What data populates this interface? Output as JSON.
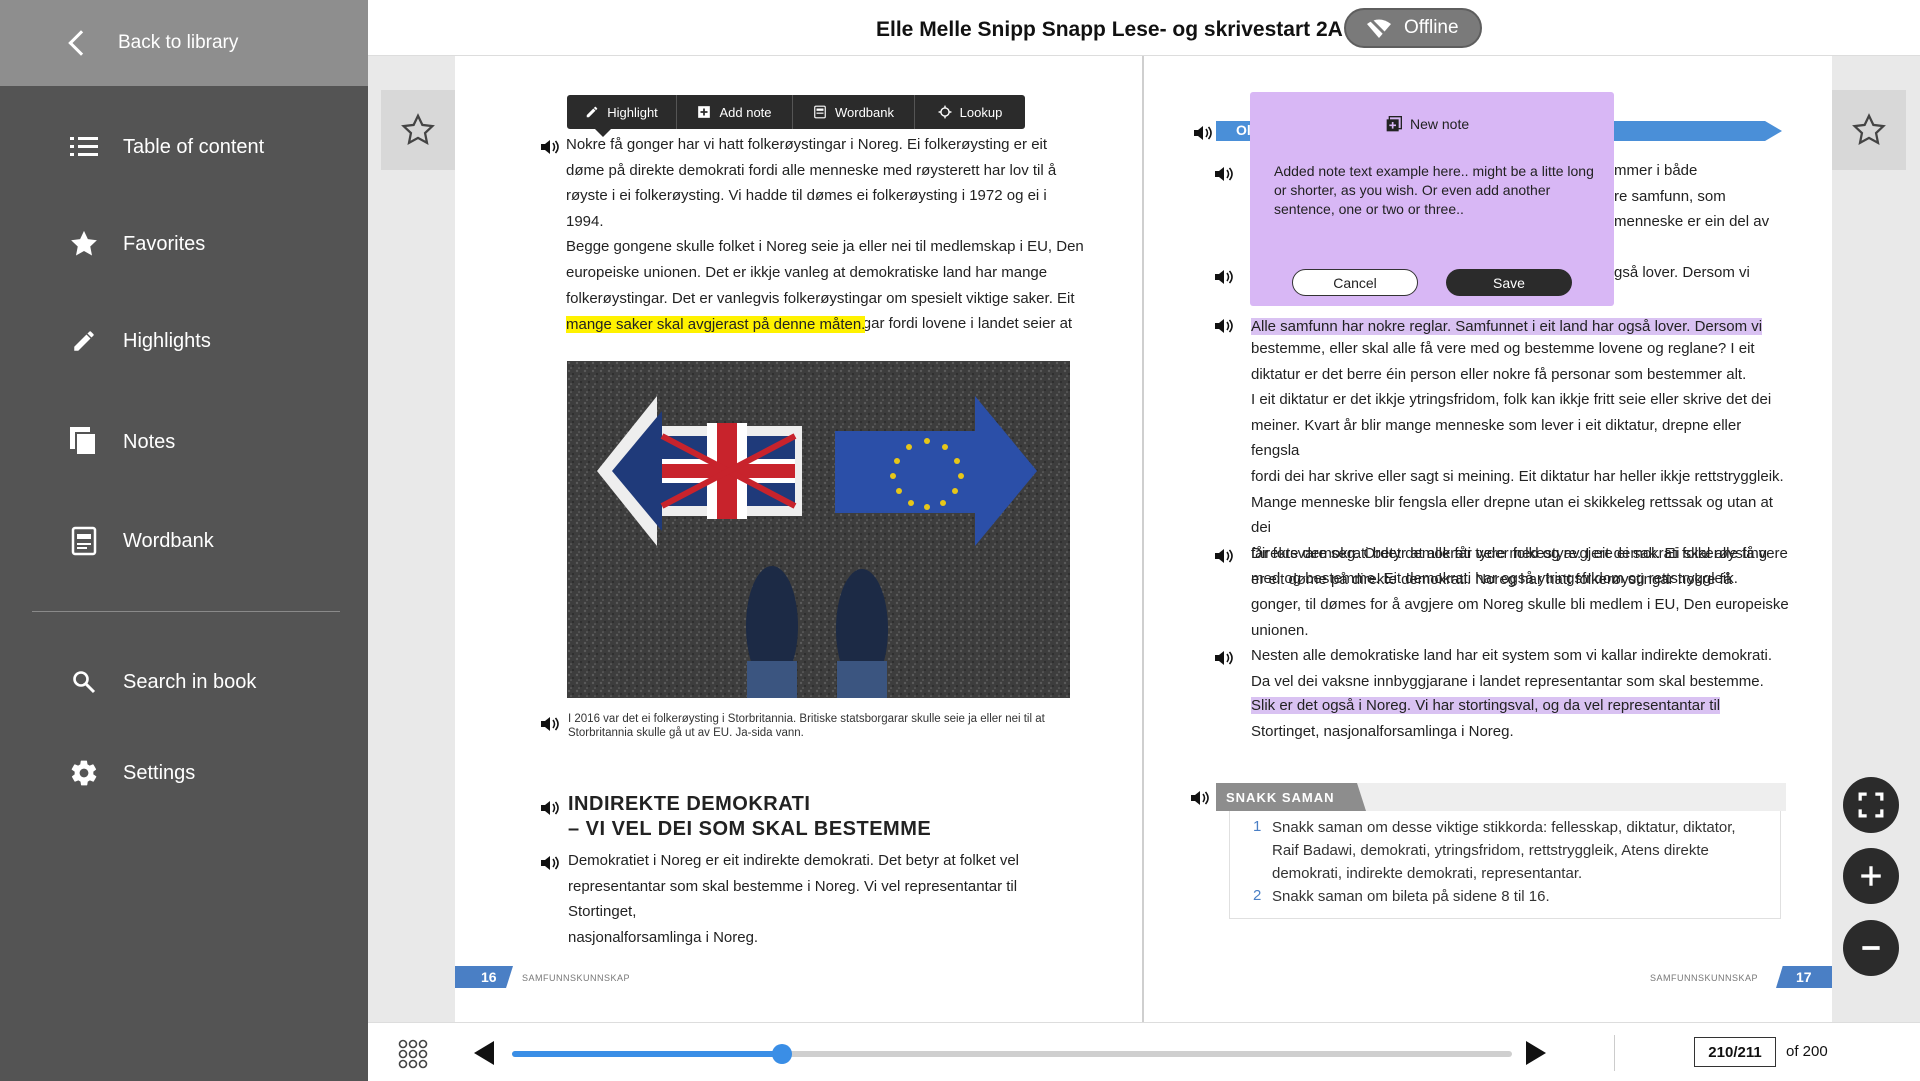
{
  "sidebar": {
    "back_label": "Back to library",
    "items": [
      {
        "label": "Table of content",
        "icon": "list-icon"
      },
      {
        "label": "Favorites",
        "icon": "star-icon"
      },
      {
        "label": "Highlights",
        "icon": "pencil-icon"
      },
      {
        "label": "Notes",
        "icon": "notes-icon"
      },
      {
        "label": "Wordbank",
        "icon": "wordbank-icon"
      },
      {
        "label": "Search in book",
        "icon": "search-icon"
      },
      {
        "label": "Settings",
        "icon": "gear-icon"
      }
    ]
  },
  "header": {
    "title": "Elle Melle Snipp Snapp Lese- og skrivestart 2A",
    "offline_label": "Offline"
  },
  "toolbar": {
    "highlight": "Highlight",
    "add_note": "Add note",
    "wordbank": "Wordbank",
    "lookup": "Lookup"
  },
  "left_page": {
    "para1": "Nokre få gonger har vi hatt folkerøystingar i Noreg. Ei folkerøysting er eit\ndøme på direkte demokrati fordi alle menneske med røysterett har lov til å\nrøyste i ei folkerøysting. Vi hadde til dømes ei folkerøysting i 1972 og ei i 1994.\nBegge gongene skulle folket i Noreg seie ja eller nei til medlemskap i EU, Den\neuropeiske unionen. Det er ikkje vanleg at demokratiske land har mange\nfolkerøystingar. Det er vanlegvis folkerøystingar om spesielt viktige saker. Eit\nunntak er Sveits som har mange folkerøystingar fordi lovene i landet seier at",
    "para1_highlight": "mange saker skal avgjerast på denne måten.",
    "caption": "I 2016 var det ei folkerøysting i Storbritannia. Britiske statsborgarar skulle seie ja eller nei til at Storbritannia skulle gå ut av EU. Ja-sida vann.",
    "heading": "INDIREKTE DEMOKRATI\n– VI VEL DEI SOM SKAL BESTEMME",
    "para2": "Demokratiet i Noreg er eit indirekte demokrati. Det betyr at folket vel\nrepresentantar som skal bestemme i Noreg. Vi vel representantar til Stortinget,\nnasjonalforsamlinga i Noreg.",
    "page_number": "16",
    "footer": "SAMFUNNSKUNNSKAP"
  },
  "right_page": {
    "banner_text": "Ol",
    "peek1a": "mmer i både",
    "peek1b": "re samfunn, som",
    "peek1c": "menneske er ein del av",
    "peek2": "gså lover. Dersom vi",
    "para_highlight": "Alle samfunn har nokre reglar. Samfunnet i eit land har også lover. Dersom vi",
    "para_rest": "bestemme, eller skal alle få vere med og bestemme lovene og reglane? I eit\ndiktatur er det berre éin person eller nokre få personar som bestemmer alt.\nI eit diktatur er det ikkje ytringsfridom, folk kan ikkje fritt seie eller skrive det dei\nmeiner. Kvart år blir mange menneske som lever i eit diktatur, drepne eller fengsla\nfordi dei har skrive eller sagt si meining. Eit diktatur har heller ikkje rettstryggleik.\nMange menneske blir fengsla eller drepne utan ei skikkeleg rettssak og utan at dei\nfår forsvare seg. Ordet demokrati tyder folkestyre. I eit demokrati skal alle få vere\nmed og bestemme. Eit demokrati har også ytringsfridom og rettstryggleik.",
    "para3": "Direkte demokrati betyr at alle får vere med og avgjere ei sak. Ei folkerøysting\ner eit døme på direkte demokrati. Noreg har hatt folkerøystingar nokre få\ngonger, til dømes for å avgjere om Noreg skulle bli medlem i EU, Den europeiske\nunionen.",
    "para4": "Nesten alle demokratiske land har eit system som vi kallar indirekte demokrati.\nDa vel dei vaksne innbyggjarane i landet representantar som skal bestemme.",
    "para4_highlight": "Slik er det også i Noreg. Vi har stortingsval, og da vel representantar til",
    "para4_end": "Stortinget, nasjonalforsamlinga i Noreg.",
    "snakk_label": "SNAKK SAMAN",
    "q1_num": "1",
    "q1": "Snakk saman om desse viktige stikkorda: fellesskap, diktatur, diktator,\nRaif Badawi, demokrati, ytringsfridom, rettstryggleik, Atens direkte\ndemokrati, indirekte demokrati, representantar.",
    "q2_num": "2",
    "q2": "Snakk saman om bileta på sidene 8 til 16.",
    "page_number": "17",
    "footer": "SAMFUNNSKUNNSKAP"
  },
  "note_popup": {
    "title": "New note",
    "body": "Added note text example here.. might be a litte long or shorter, as you wish. Or even add another sentence, one or two or three..",
    "cancel": "Cancel",
    "save": "Save"
  },
  "bottom_bar": {
    "progress": 0.27,
    "page_current": "210/211",
    "page_total": "of 200"
  },
  "colors": {
    "sidebar_bg": "#545454",
    "accent_blue": "#3a8ee6",
    "highlight_yellow": "#fff200",
    "highlight_purple": "#d9c2f2",
    "note_bg": "#d8b7f5"
  }
}
